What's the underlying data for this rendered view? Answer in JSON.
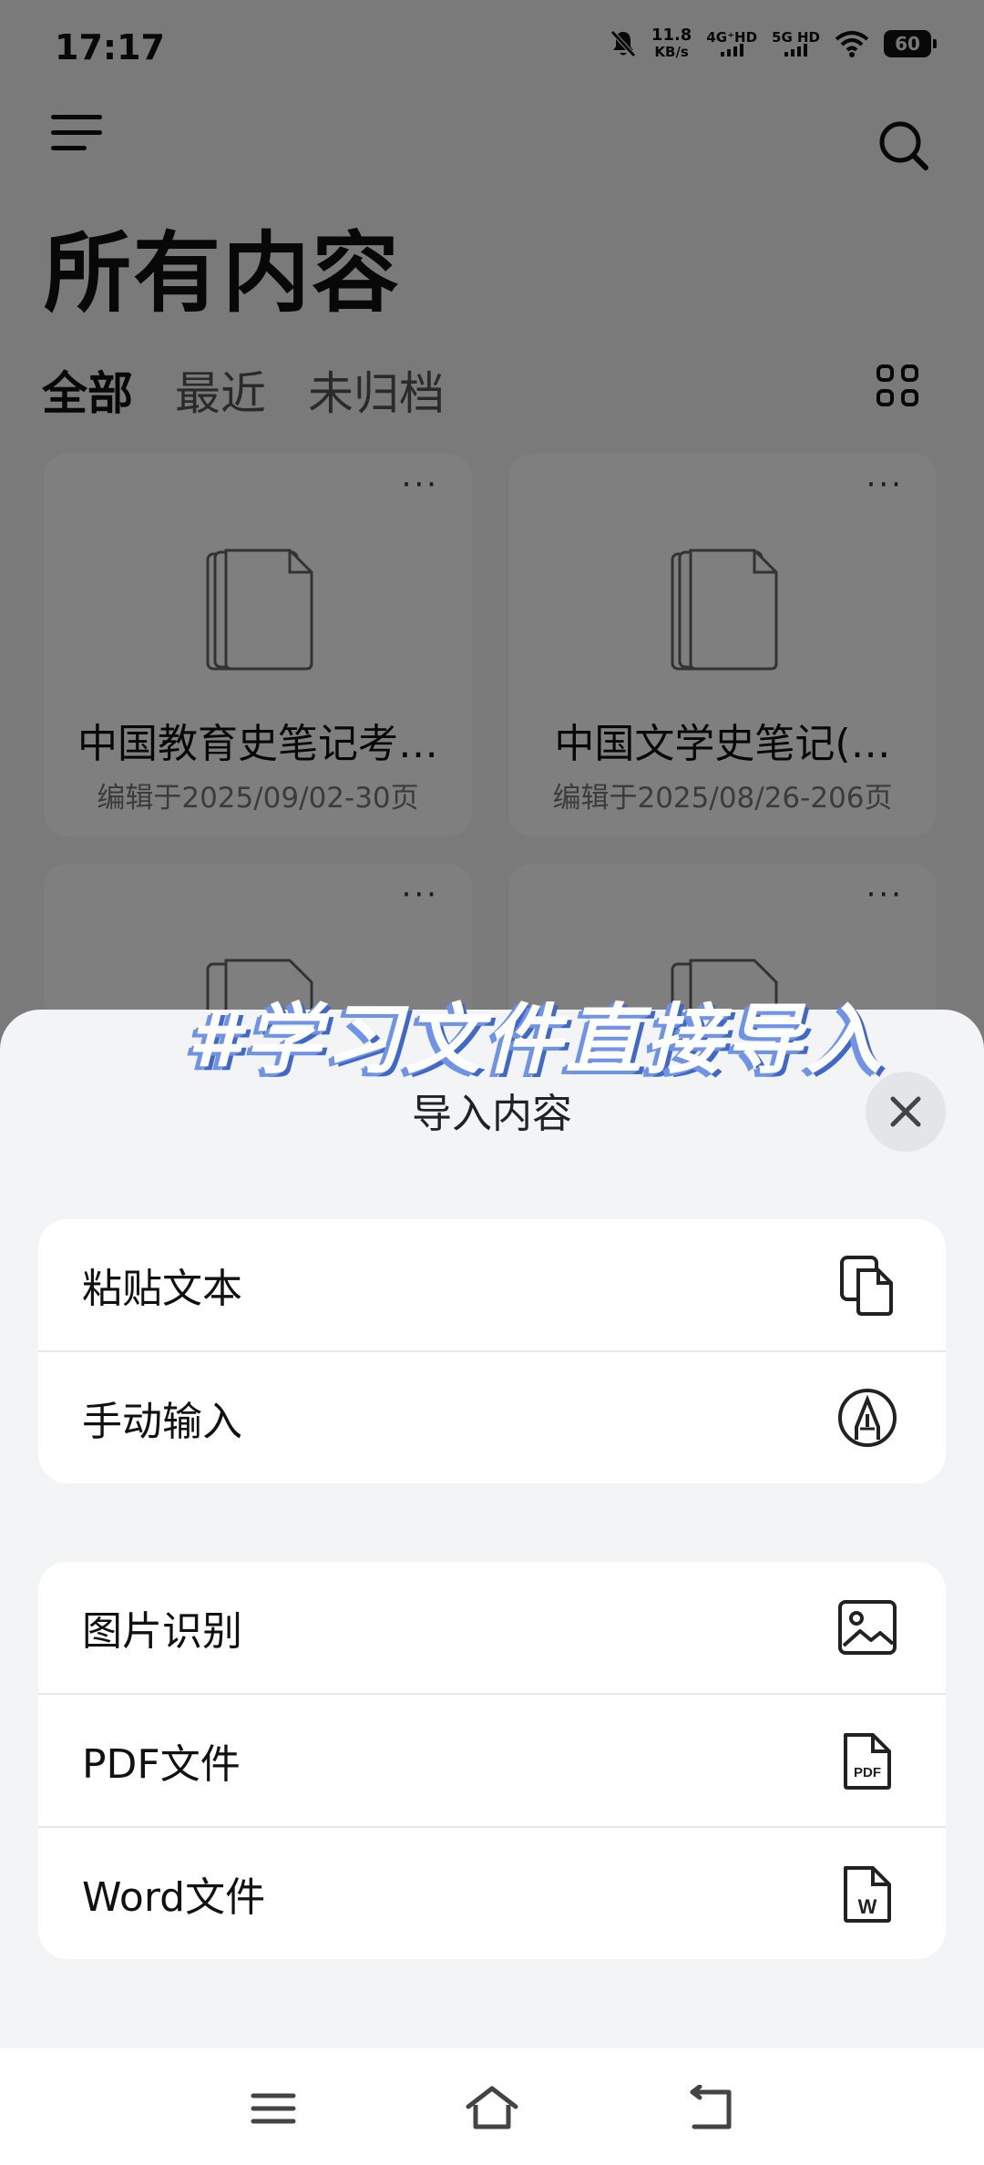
{
  "status_bar": {
    "time": "17:17",
    "speed_value": "11.8",
    "speed_unit": "KB/s",
    "net1": "4G⁺HD",
    "net2": "5G HD",
    "battery": "60"
  },
  "header": {
    "title": "所有内容",
    "tabs": [
      {
        "label": "全部",
        "active": true
      },
      {
        "label": "最近",
        "active": false
      },
      {
        "label": "未归档",
        "active": false
      }
    ]
  },
  "cards": [
    {
      "title": "中国教育史笔记考…",
      "meta": "编辑于2025/09/02-30页",
      "more": "···"
    },
    {
      "title": "中国文学史笔记(…",
      "meta": "编辑于2025/08/26-206页",
      "more": "···"
    },
    {
      "title": "",
      "meta": "",
      "more": "···"
    },
    {
      "title": "",
      "meta": "",
      "more": "···"
    }
  ],
  "overlay_caption": "#学习文件直接导入",
  "sheet": {
    "title": "导入内容",
    "group1": [
      {
        "label": "粘贴文本",
        "icon": "paste-icon"
      },
      {
        "label": "手动输入",
        "icon": "pen-icon"
      }
    ],
    "group2": [
      {
        "label": "图片识别",
        "icon": "image-icon"
      },
      {
        "label": "PDF文件",
        "icon": "pdf-icon"
      },
      {
        "label": "Word文件",
        "icon": "word-icon"
      }
    ],
    "pdf_icon_text": "PDF",
    "word_icon_text": "W"
  },
  "colors": {
    "overlay_text_shadow": "#6f93e6",
    "sheet_bg": "#f2f4f6",
    "dim": "rgba(0,0,0,0.5)"
  }
}
